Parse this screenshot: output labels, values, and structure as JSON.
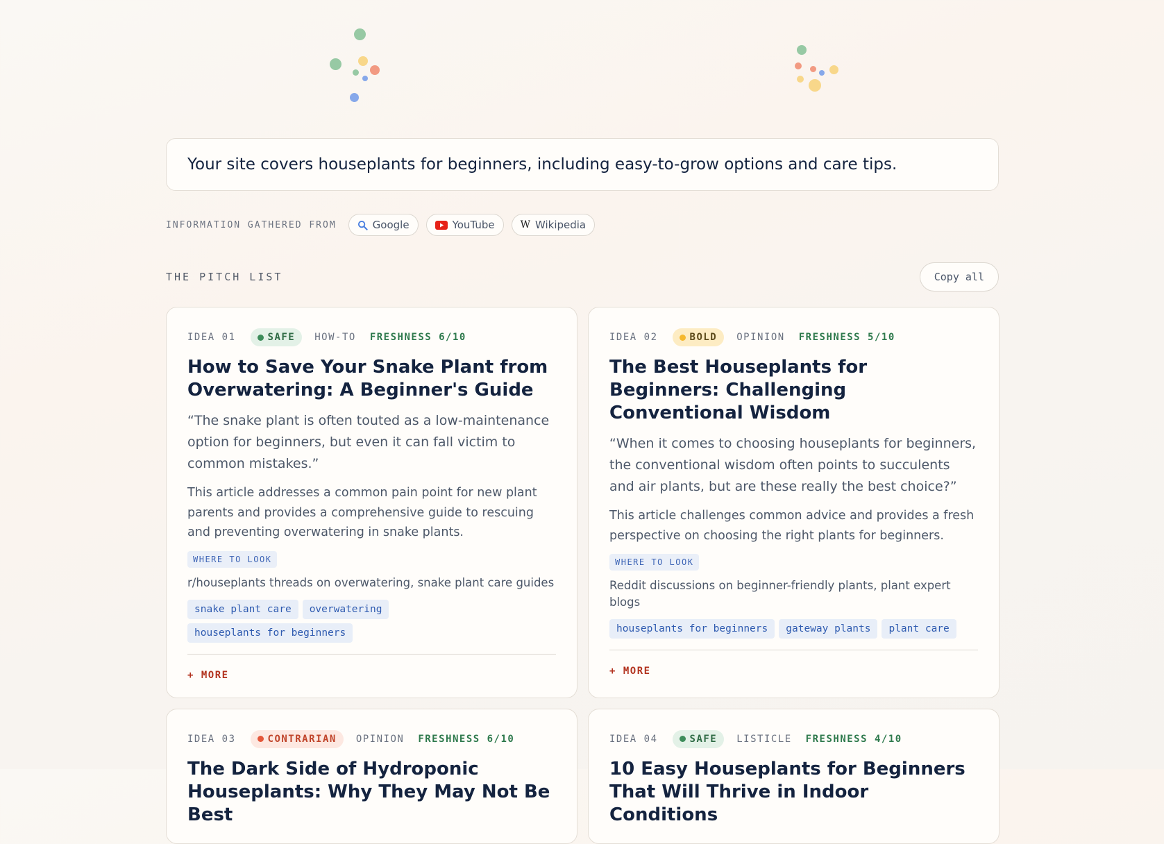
{
  "description": "Your site covers houseplants for beginners, including easy-to-grow options and care tips.",
  "sources": {
    "label": "INFORMATION GATHERED FROM",
    "items": [
      {
        "name": "Google",
        "icon": "search-icon"
      },
      {
        "name": "YouTube",
        "icon": "youtube-icon"
      },
      {
        "name": "Wikipedia",
        "icon": "wikipedia-icon"
      }
    ]
  },
  "pitch_list": {
    "title": "THE PITCH LIST",
    "copy_label": "Copy all"
  },
  "colors": {
    "safe": "#3d8c5a",
    "bold": "#f5b82e",
    "contrarian": "#e4573a",
    "more": "#b2321e",
    "tag": "#2f5bb0"
  },
  "ideas": [
    {
      "num": "IDEA 01",
      "badge": "SAFE",
      "type": "HOW-TO",
      "freshness": "FRESHNESS 6/10",
      "title": "How to Save Your Snake Plant from Overwatering: A Beginner's Guide",
      "quote": "“The snake plant is often touted as a low-maintenance option for beginners, but even it can fall victim to common mistakes.”",
      "body": "This article addresses a common pain point for new plant parents and provides a comprehensive guide to rescuing and preventing overwatering in snake plants.",
      "where_label": "WHERE TO LOOK",
      "where": "r/houseplants threads on overwatering, snake plant care guides",
      "tags": [
        "snake plant care",
        "overwatering",
        "houseplants for beginners"
      ],
      "more": "+ MORE"
    },
    {
      "num": "IDEA 02",
      "badge": "BOLD",
      "type": "OPINION",
      "freshness": "FRESHNESS 5/10",
      "title": "The Best Houseplants for Beginners: Challenging Conventional Wisdom",
      "quote": "“When it comes to choosing houseplants for beginners, the conventional wisdom often points to succulents and air plants, but are these really the best choice?”",
      "body": "This article challenges common advice and provides a fresh perspective on choosing the right plants for beginners.",
      "where_label": "WHERE TO LOOK",
      "where": "Reddit discussions on beginner-friendly plants, plant expert blogs",
      "tags": [
        "houseplants for beginners",
        "gateway plants",
        "plant care"
      ],
      "more": "+ MORE"
    },
    {
      "num": "IDEA 03",
      "badge": "CONTRARIAN",
      "type": "OPINION",
      "freshness": "FRESHNESS 6/10",
      "title": "The Dark Side of Hydroponic Houseplants: Why They May Not Be Best"
    },
    {
      "num": "IDEA 04",
      "badge": "SAFE",
      "type": "LISTICLE",
      "freshness": "FRESHNESS 4/10",
      "title": "10 Easy Houseplants for Beginners That Will Thrive in Indoor Conditions"
    }
  ]
}
